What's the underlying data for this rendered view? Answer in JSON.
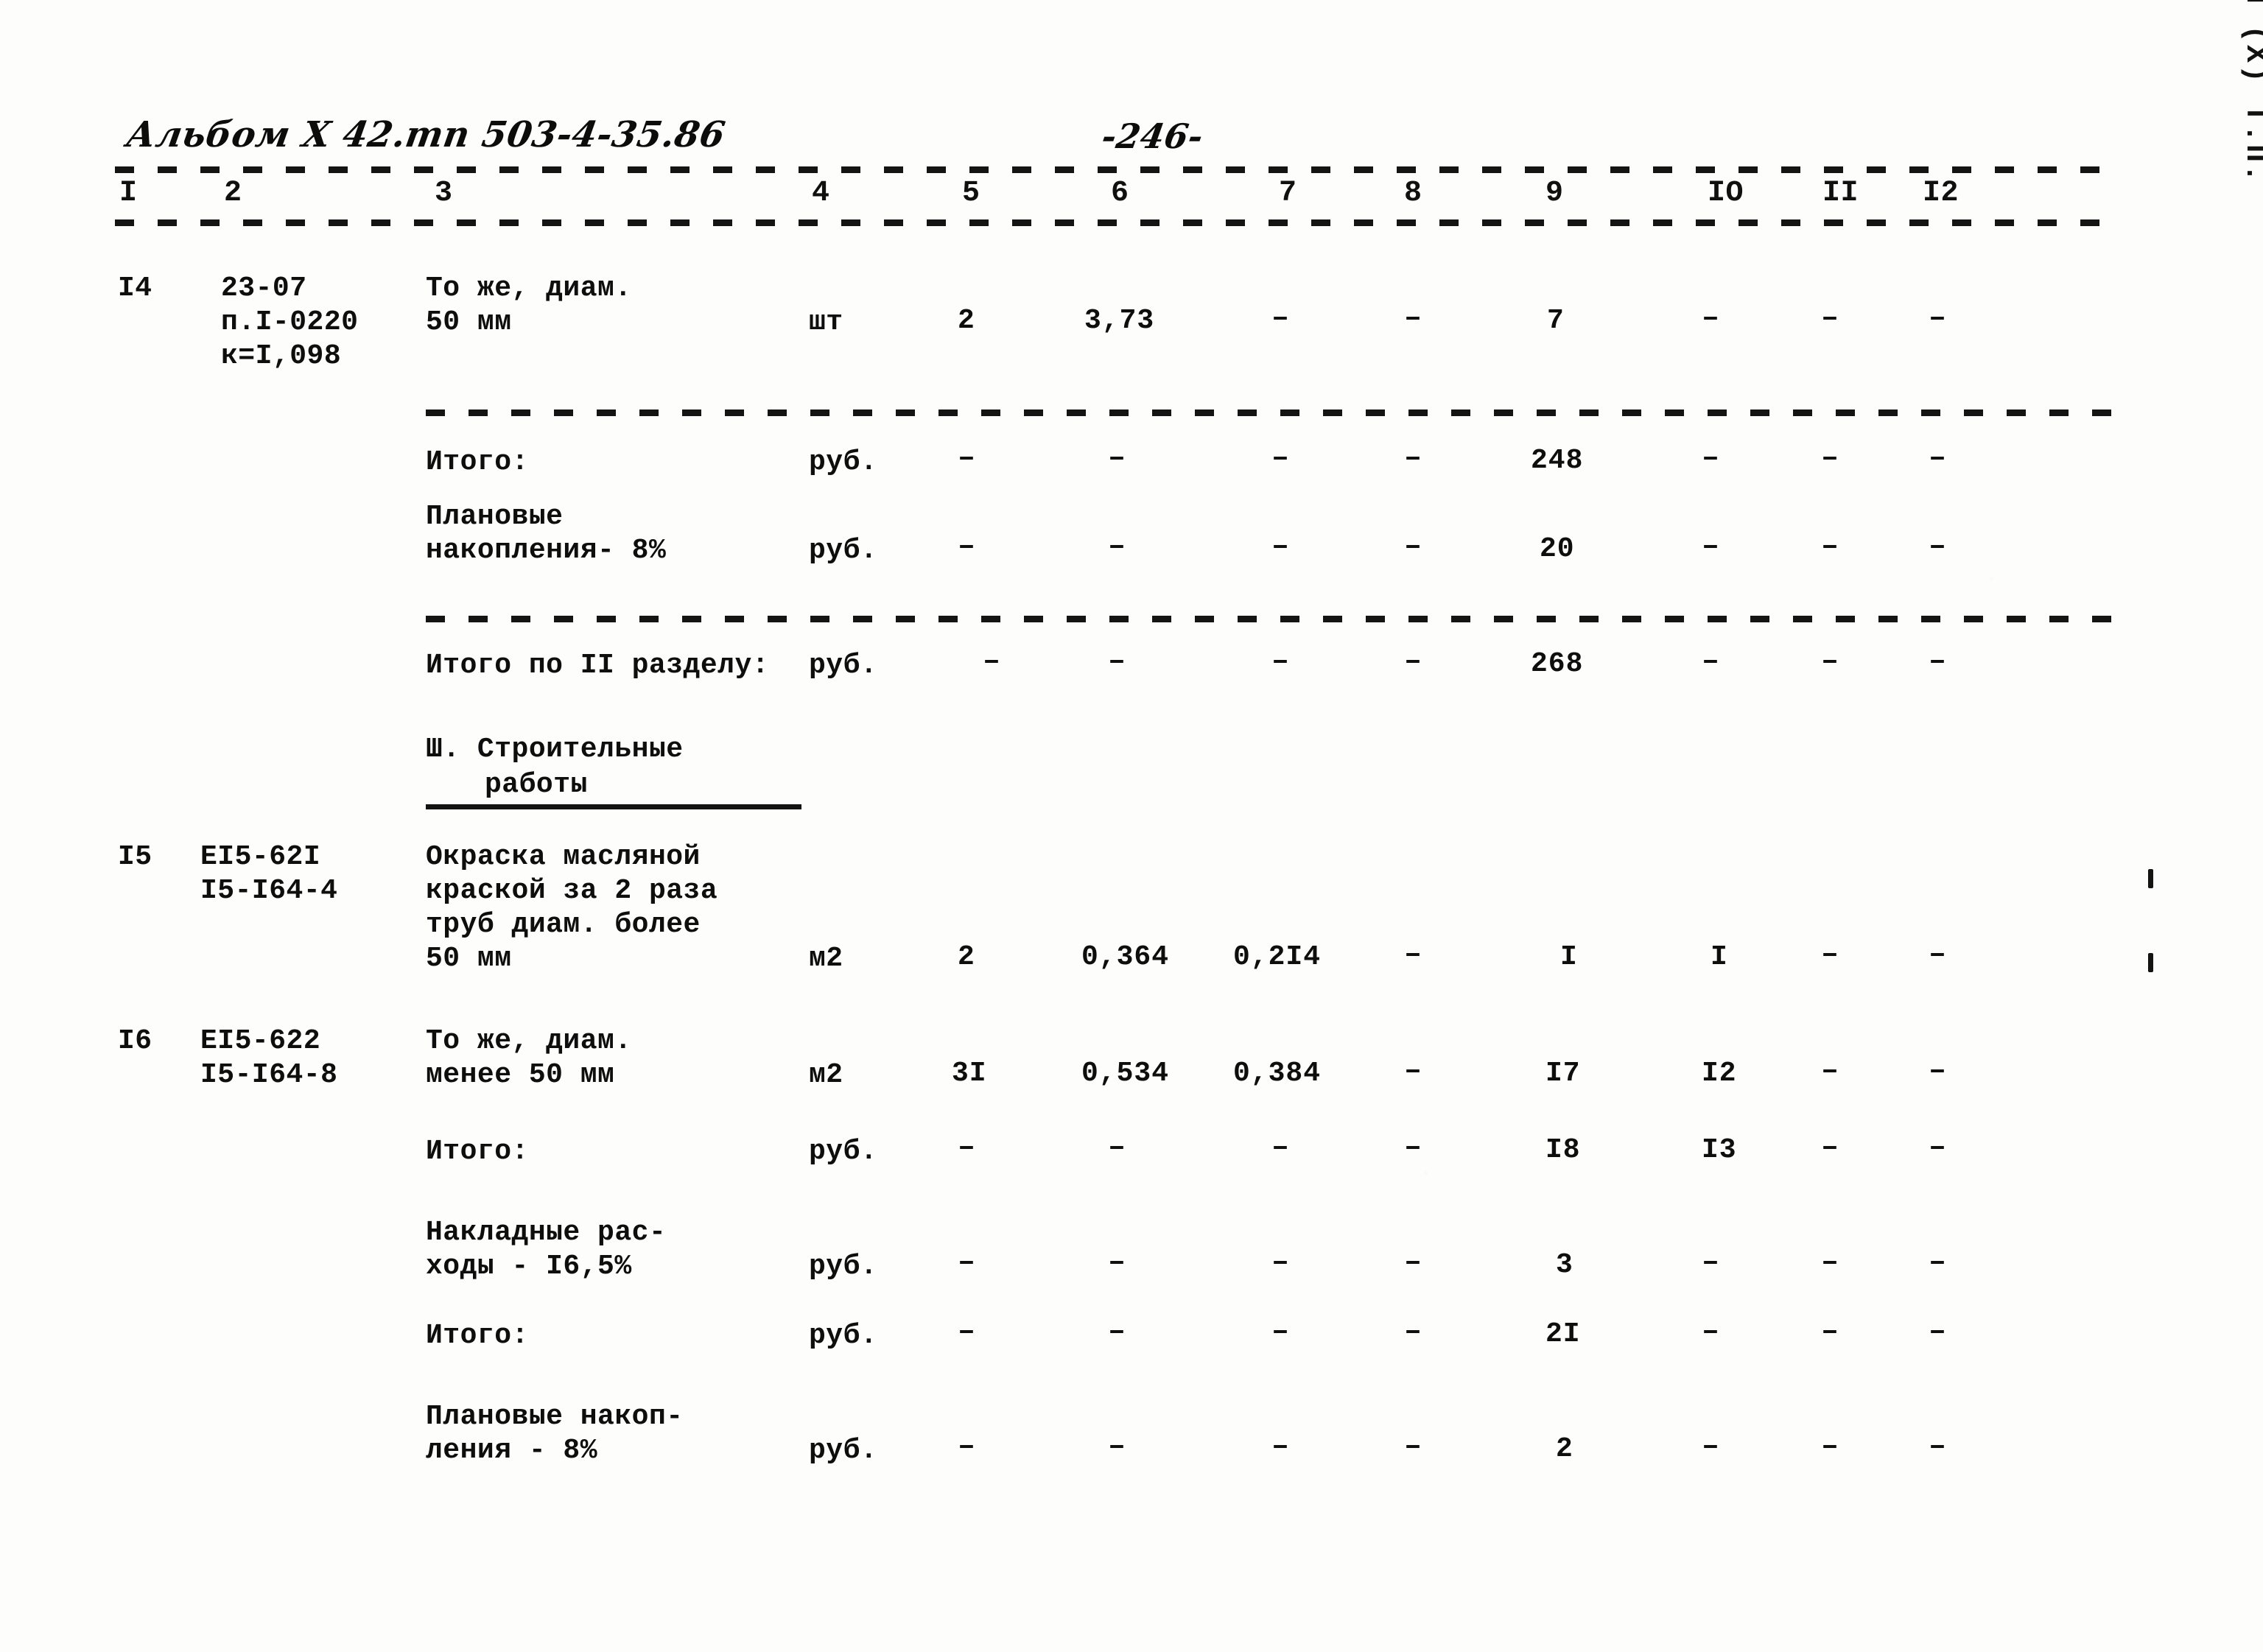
{
  "page": {
    "header_handwritten": "Альбом X 42.тп 503-4-35.86",
    "page_number_handwritten": "-246-",
    "side_caption": "Альбом (X) Т.П."
  },
  "table": {
    "column_numbers": [
      "I",
      "2",
      "3",
      "4",
      "5",
      "6",
      "7",
      "8",
      "9",
      "IO",
      "II",
      "I2"
    ],
    "rows": [
      {
        "kind": "item",
        "no": "I4",
        "code_lines": [
          "23-07",
          "п.I-0220",
          "к=I,098"
        ],
        "desc_lines": [
          "То же, диам.",
          "50 мм"
        ],
        "unit": "шт",
        "c5": "2",
        "c6": "3,73",
        "c7": "–",
        "c8": "–",
        "c9": "7",
        "c10": "–",
        "c11": "–",
        "c12": "–"
      },
      {
        "kind": "total",
        "desc_lines": [
          "Итого:"
        ],
        "unit": "руб.",
        "c5": "–",
        "c6": "–",
        "c7": "–",
        "c8": "–",
        "c9": "248",
        "c10": "–",
        "c11": "–",
        "c12": "–"
      },
      {
        "kind": "total",
        "desc_lines": [
          "Плановые",
          "накопления- 8%"
        ],
        "unit": "руб.",
        "c5": "–",
        "c6": "–",
        "c7": "–",
        "c8": "–",
        "c9": "20",
        "c10": "–",
        "c11": "–",
        "c12": "–"
      },
      {
        "kind": "grandtotal",
        "desc_lines": [
          "Итого по II разделу:"
        ],
        "unit": "руб.",
        "c5": "–",
        "c6": "–",
        "c7": "–",
        "c8": "–",
        "c9": "268",
        "c10": "–",
        "c11": "–",
        "c12": "–"
      },
      {
        "kind": "section",
        "desc_lines": [
          "Ш. Строительные",
          "работы"
        ]
      },
      {
        "kind": "item",
        "no": "I5",
        "code_lines": [
          "ЕI5-62I",
          "I5-I64-4"
        ],
        "desc_lines": [
          "Окраска масляной",
          "краской за 2 раза",
          "труб диам. более",
          "50 мм"
        ],
        "unit": "м2",
        "c5": "2",
        "c6": "0,364",
        "c7": "0,2I4",
        "c8": "–",
        "c9": "I",
        "c10": "I",
        "c11": "–",
        "c12": "–"
      },
      {
        "kind": "item",
        "no": "I6",
        "code_lines": [
          "ЕI5-622",
          "I5-I64-8"
        ],
        "desc_lines": [
          "То же, диам.",
          "менее 50 мм"
        ],
        "unit": "м2",
        "c5": "3I",
        "c6": "0,534",
        "c7": "0,384",
        "c8": "–",
        "c9": "I7",
        "c10": "I2",
        "c11": "–",
        "c12": "–"
      },
      {
        "kind": "total",
        "desc_lines": [
          "Итого:"
        ],
        "unit": "руб.",
        "c5": "–",
        "c6": "–",
        "c7": "–",
        "c8": "–",
        "c9": "I8",
        "c10": "I3",
        "c11": "–",
        "c12": "–"
      },
      {
        "kind": "total",
        "desc_lines": [
          "Накладные рас-",
          "ходы - I6,5%"
        ],
        "unit": "руб.",
        "c5": "–",
        "c6": "–",
        "c7": "–",
        "c8": "–",
        "c9": "3",
        "c10": "–",
        "c11": "–",
        "c12": "–"
      },
      {
        "kind": "total",
        "desc_lines": [
          "Итого:"
        ],
        "unit": "руб.",
        "c5": "–",
        "c6": "–",
        "c7": "–",
        "c8": "–",
        "c9": "2I",
        "c10": "–",
        "c11": "–",
        "c12": "–"
      },
      {
        "kind": "total",
        "desc_lines": [
          "Плановые накоп-",
          "ления - 8%"
        ],
        "unit": "руб.",
        "c5": "–",
        "c6": "–",
        "c7": "–",
        "c8": "–",
        "c9": "2",
        "c10": "–",
        "c11": "–",
        "c12": "–"
      }
    ]
  }
}
